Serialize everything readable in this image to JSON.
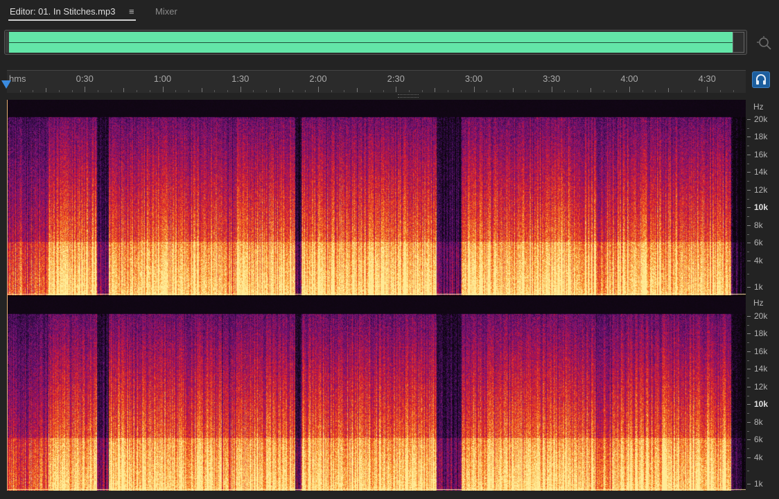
{
  "tabs": {
    "editor_label": "Editor: 01. In Stitches.mp3",
    "menu_icon": "≡",
    "mixer_label": "Mixer"
  },
  "overview": {
    "wave_color": "#63e6a8"
  },
  "ruler": {
    "unit_label": "hms",
    "labels": [
      "0:30",
      "1:00",
      "1:30",
      "2:00",
      "2:30",
      "3:00",
      "3:30",
      "4:00",
      "4:30"
    ],
    "duration_seconds": 286
  },
  "spectral": {
    "hz_unit": "Hz",
    "hz_labels": [
      "20k",
      "18k",
      "16k",
      "14k",
      "12k",
      "10k",
      "8k",
      "6k",
      "4k",
      "1k"
    ],
    "hz_emphasized": "10k",
    "channels": 2
  },
  "icons": {
    "zoom": "zoom-to-fit-icon",
    "monitor": "headphones-icon",
    "playhead": "playhead-marker-icon"
  }
}
